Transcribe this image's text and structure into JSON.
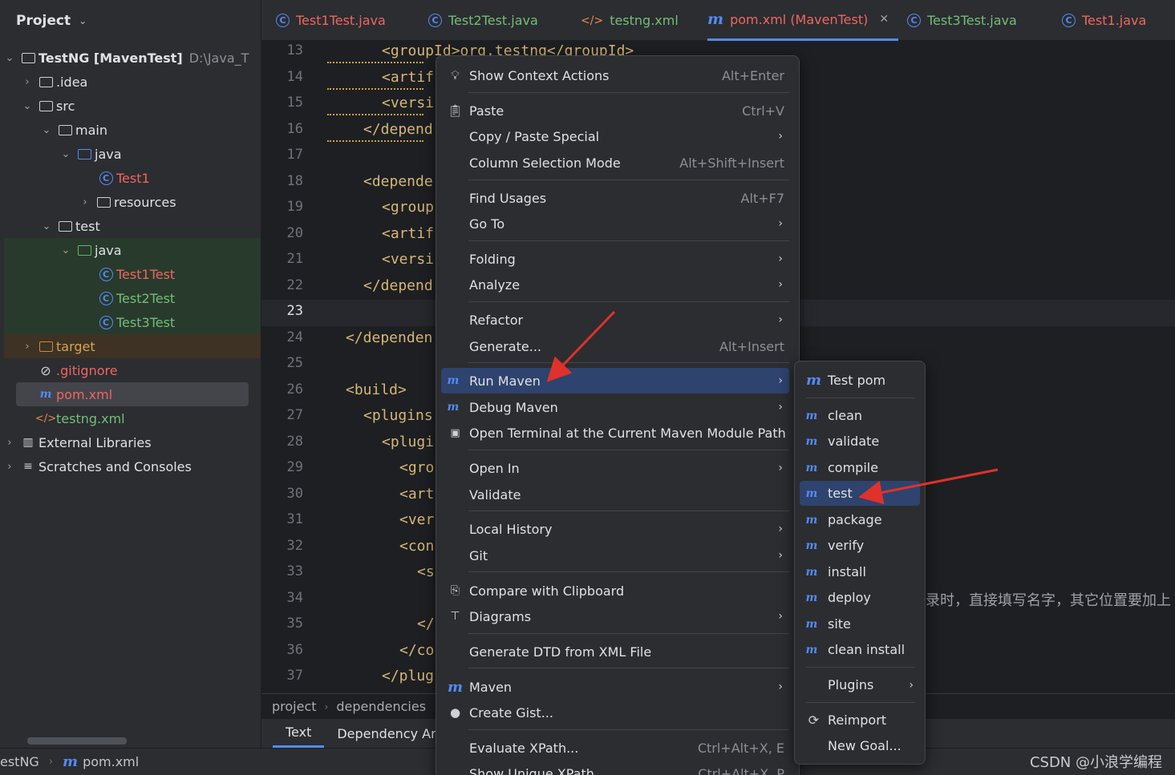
{
  "project": {
    "title": "Project",
    "tree": [
      {
        "label": "TestNG [MavenTest]",
        "path": "D:\\Java_T"
      },
      {
        "label": ".idea"
      },
      {
        "label": "src"
      },
      {
        "label": "main"
      },
      {
        "label": "java"
      },
      {
        "label": "Test1"
      },
      {
        "label": "resources"
      },
      {
        "label": "test"
      },
      {
        "label": "java"
      },
      {
        "label": "Test1Test"
      },
      {
        "label": "Test2Test"
      },
      {
        "label": "Test3Test"
      },
      {
        "label": "target"
      },
      {
        "label": ".gitignore"
      },
      {
        "label": "pom.xml"
      },
      {
        "label": "testng.xml"
      },
      {
        "label": "External Libraries"
      },
      {
        "label": "Scratches and Consoles"
      }
    ]
  },
  "tabs": [
    {
      "label": "Test1Test.java"
    },
    {
      "label": "Test2Test.java"
    },
    {
      "label": "testng.xml"
    },
    {
      "label": "pom.xml (MavenTest)"
    },
    {
      "label": "Test3Test.java"
    },
    {
      "label": "Test1.java"
    }
  ],
  "editor": {
    "line_numbers": [
      "13",
      "14",
      "15",
      "16",
      "17",
      "18",
      "19",
      "20",
      "21",
      "22",
      "23",
      "24",
      "25",
      "26",
      "27",
      "28",
      "29",
      "30",
      "31",
      "32",
      "33",
      "34",
      "35",
      "36",
      "37"
    ],
    "lines": [
      "<groupId>org.testng</groupId>",
      "<artif",
      "<versi",
      "</depend",
      "",
      "<depende",
      "<group",
      "<artif",
      "<versi",
      "</depend",
      "",
      "</dependen",
      "",
      "<build>",
      "<plugins",
      "<plugi",
      "<gro",
      "<art",
      "<ver",
      "<con",
      "<s",
      "",
      "</",
      "</co",
      "</plug"
    ],
    "comment_fragment": "录时，直接填写名字，其它位置要加上"
  },
  "breadcrumbs": [
    "project",
    "dependencies"
  ],
  "bottom_tabs": [
    "Text",
    "Dependency An"
  ],
  "status": {
    "project": "estNG",
    "file": "pom.xml"
  },
  "watermark": "CSDN @小浪学编程",
  "context_menu": {
    "items": [
      {
        "label": "Show Context Actions",
        "shortcut": "Alt+Enter"
      },
      {
        "label": "Paste",
        "shortcut": "Ctrl+V"
      },
      {
        "label": "Copy / Paste Special"
      },
      {
        "label": "Column Selection Mode",
        "shortcut": "Alt+Shift+Insert"
      },
      {
        "label": "Find Usages",
        "shortcut": "Alt+F7"
      },
      {
        "label": "Go To"
      },
      {
        "label": "Folding"
      },
      {
        "label": "Analyze"
      },
      {
        "label": "Refactor"
      },
      {
        "label": "Generate...",
        "shortcut": "Alt+Insert"
      },
      {
        "label": "Run Maven"
      },
      {
        "label": "Debug Maven"
      },
      {
        "label": "Open Terminal at the Current Maven Module Path"
      },
      {
        "label": "Open In"
      },
      {
        "label": "Validate"
      },
      {
        "label": "Local History"
      },
      {
        "label": "Git"
      },
      {
        "label": "Compare with Clipboard"
      },
      {
        "label": "Diagrams"
      },
      {
        "label": "Generate DTD from XML File"
      },
      {
        "label": "Maven"
      },
      {
        "label": "Create Gist..."
      },
      {
        "label": "Evaluate XPath...",
        "shortcut": "Ctrl+Alt+X, E"
      },
      {
        "label": "Show Unique XPath",
        "shortcut": "Ctrl+Alt+X, P"
      }
    ]
  },
  "run_maven_submenu": {
    "items": [
      {
        "label": "Test pom"
      },
      {
        "label": "clean"
      },
      {
        "label": "validate"
      },
      {
        "label": "compile"
      },
      {
        "label": "test"
      },
      {
        "label": "package"
      },
      {
        "label": "verify"
      },
      {
        "label": "install"
      },
      {
        "label": "deploy"
      },
      {
        "label": "site"
      },
      {
        "label": "clean install"
      },
      {
        "label": "Plugins"
      },
      {
        "label": "Reimport"
      },
      {
        "label": "New Goal..."
      }
    ]
  },
  "colors": {
    "accent": "#548af7",
    "selection": "#2e436e",
    "annotation_arrow": "#e0312b"
  }
}
